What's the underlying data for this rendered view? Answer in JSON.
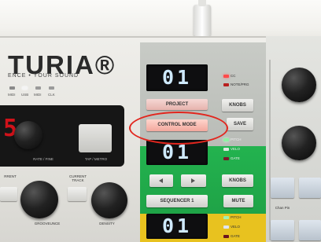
{
  "brand": {
    "name": "TURIA®",
    "tagline": "ENCE • YOUR SOUND"
  },
  "indicators": [
    "MIDI",
    "USB",
    "MIDI",
    "CLK"
  ],
  "left_panel": {
    "display_value": "5",
    "knob_label": "RATE / FINE",
    "pad_label": "TAP / METRO",
    "current_track_label": "CURRENT TRACK",
    "current_label": "RRENT",
    "bottom_left_label": "GROOVEUNCE",
    "bottom_right_label": "DENSITY"
  },
  "project_section": {
    "display_value": "01",
    "project_button": "PROJECT",
    "control_mode_button": "CONTROL MODE",
    "knobs_button": "KNOBS",
    "save_button": "SAVE",
    "leds": [
      {
        "label": "CC",
        "color": "#ff4a4a"
      },
      {
        "label": "NOTE/PRG",
        "color": "#b8201f"
      }
    ]
  },
  "green_section": {
    "display_value": "01",
    "leds": [
      {
        "label": "PITCH",
        "color": "#8ff0a4"
      },
      {
        "label": "VELO",
        "color": "#dfe7e2"
      },
      {
        "label": "GATE",
        "color": "#7a1a2a"
      }
    ],
    "knobs_button": "KNOBS",
    "sequencer_button": "SEQUENCER 1",
    "mute_button": "MUTE"
  },
  "yellow_section": {
    "display_value": "01",
    "leds": [
      {
        "label": "PITCH",
        "color": "#a3f0b0"
      },
      {
        "label": "VELO",
        "color": "#dfe4f4"
      },
      {
        "label": "GATE",
        "color": "#6a1420"
      }
    ]
  },
  "right_panel": {
    "bottom_label": "Chan Pin"
  },
  "colors": {
    "highlight": "#e2261e",
    "green_strip": "#23b34f",
    "yellow_strip": "#e8c21f",
    "led_red": "#d0121a"
  }
}
